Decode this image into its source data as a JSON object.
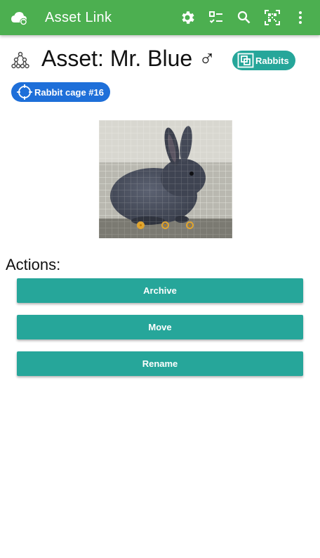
{
  "header": {
    "title": "Asset Link",
    "icons": [
      "cloud-sync-icon",
      "settings-gear-icon",
      "checklist-icon",
      "search-icon",
      "qr-scan-icon",
      "more-vert-icon"
    ],
    "color": "#4caf50"
  },
  "asset": {
    "heading": "Asset: Mr. Blue ♂",
    "group_chip": "Rabbits",
    "location_chip": "Rabbit cage #16"
  },
  "carousel": {
    "image": "gray rabbit in wire cage",
    "slide_count": 3,
    "active_slide": 1
  },
  "actions": {
    "title": "Actions:",
    "archive_label": "Archive",
    "move_label": "Move",
    "rename_label": "Rename",
    "button_color": "#26a69a"
  }
}
